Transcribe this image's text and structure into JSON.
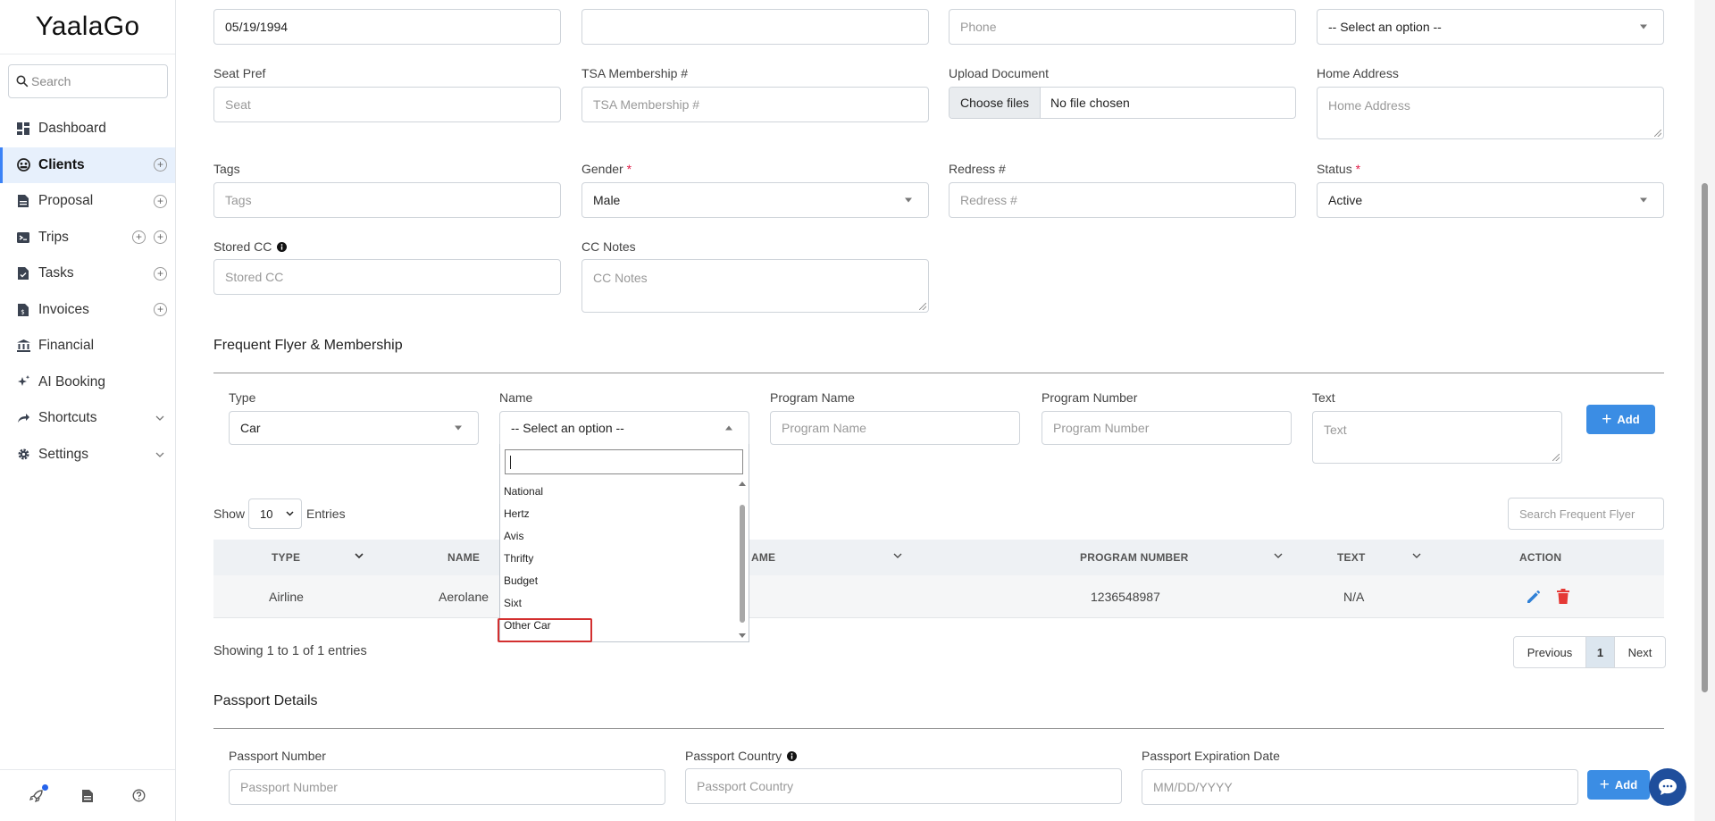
{
  "app": {
    "logo": "YaalaGo"
  },
  "sidebar": {
    "search_placeholder": "Search",
    "items": [
      {
        "label": "Dashboard",
        "icon": "dashboard-icon"
      },
      {
        "label": "Clients",
        "icon": "clients-icon",
        "active": true
      },
      {
        "label": "Proposal",
        "icon": "document-icon"
      },
      {
        "label": "Trips",
        "icon": "trips-icon"
      },
      {
        "label": "Tasks",
        "icon": "tasks-icon"
      },
      {
        "label": "Invoices",
        "icon": "invoice-icon"
      },
      {
        "label": "Financial",
        "icon": "bank-icon"
      },
      {
        "label": "AI Booking",
        "icon": "sparkle-icon"
      },
      {
        "label": "Shortcuts",
        "icon": "share-icon"
      },
      {
        "label": "Settings",
        "icon": "gear-icon"
      }
    ],
    "footer_icons": [
      "rocket-icon",
      "file-icon",
      "help-icon"
    ]
  },
  "form": {
    "dob_value": "05/19/1994",
    "phone_placeholder": "Phone",
    "select_placeholder": "-- Select an option --",
    "seat_pref": {
      "label": "Seat Pref",
      "placeholder": "Seat"
    },
    "tsa": {
      "label": "TSA Membership #",
      "placeholder": "TSA Membership #"
    },
    "upload": {
      "label": "Upload Document",
      "button": "Choose files",
      "status": "No file chosen"
    },
    "home_address": {
      "label": "Home Address",
      "placeholder": "Home Address"
    },
    "tags": {
      "label": "Tags",
      "placeholder": "Tags"
    },
    "gender": {
      "label": "Gender",
      "required": "*",
      "value": "Male"
    },
    "redress": {
      "label": "Redress #",
      "placeholder": "Redress #"
    },
    "status": {
      "label": "Status",
      "required": "*",
      "value": "Active"
    },
    "stored_cc": {
      "label": "Stored CC",
      "placeholder": "Stored CC"
    },
    "cc_notes": {
      "label": "CC Notes",
      "placeholder": "CC Notes"
    }
  },
  "frequent_flyer": {
    "title": "Frequent Flyer & Membership",
    "type": {
      "label": "Type",
      "value": "Car"
    },
    "name": {
      "label": "Name",
      "value": "-- Select an option --"
    },
    "program_name": {
      "label": "Program Name",
      "placeholder": "Program Name"
    },
    "program_number": {
      "label": "Program Number",
      "placeholder": "Program Number"
    },
    "text": {
      "label": "Text",
      "placeholder": "Text"
    },
    "add_label": "Add",
    "dropdown_options": [
      "National",
      "Hertz",
      "Avis",
      "Thrifty",
      "Budget",
      "Sixt",
      "Other Car"
    ]
  },
  "table": {
    "show_label": "Show",
    "entries_value": "10",
    "entries_label": "Entries",
    "search_placeholder": "Search Frequent Flyer",
    "headers": {
      "type": "TYPE",
      "name": "NAME",
      "program_name_partial": "AME",
      "program_number": "PROGRAM NUMBER",
      "text": "TEXT",
      "action": "ACTION"
    },
    "rows": [
      {
        "type": "Airline",
        "name": "Aerolane",
        "program_number": "1236548987",
        "text": "N/A"
      }
    ],
    "info": "Showing 1 to 1 of 1 entries",
    "pager": {
      "previous": "Previous",
      "current": "1",
      "next": "Next"
    }
  },
  "passport": {
    "title": "Passport Details",
    "number": {
      "label": "Passport Number",
      "placeholder": "Passport Number"
    },
    "country": {
      "label": "Passport Country",
      "placeholder": "Passport Country"
    },
    "expiration": {
      "label": "Passport Expiration Date",
      "placeholder": "MM/DD/YYYY"
    },
    "add_label": "Add"
  },
  "colors": {
    "accent": "#3b8de4",
    "active_bg": "#e7f0fc",
    "danger": "#e53935",
    "highlight": "#d32f2f"
  }
}
